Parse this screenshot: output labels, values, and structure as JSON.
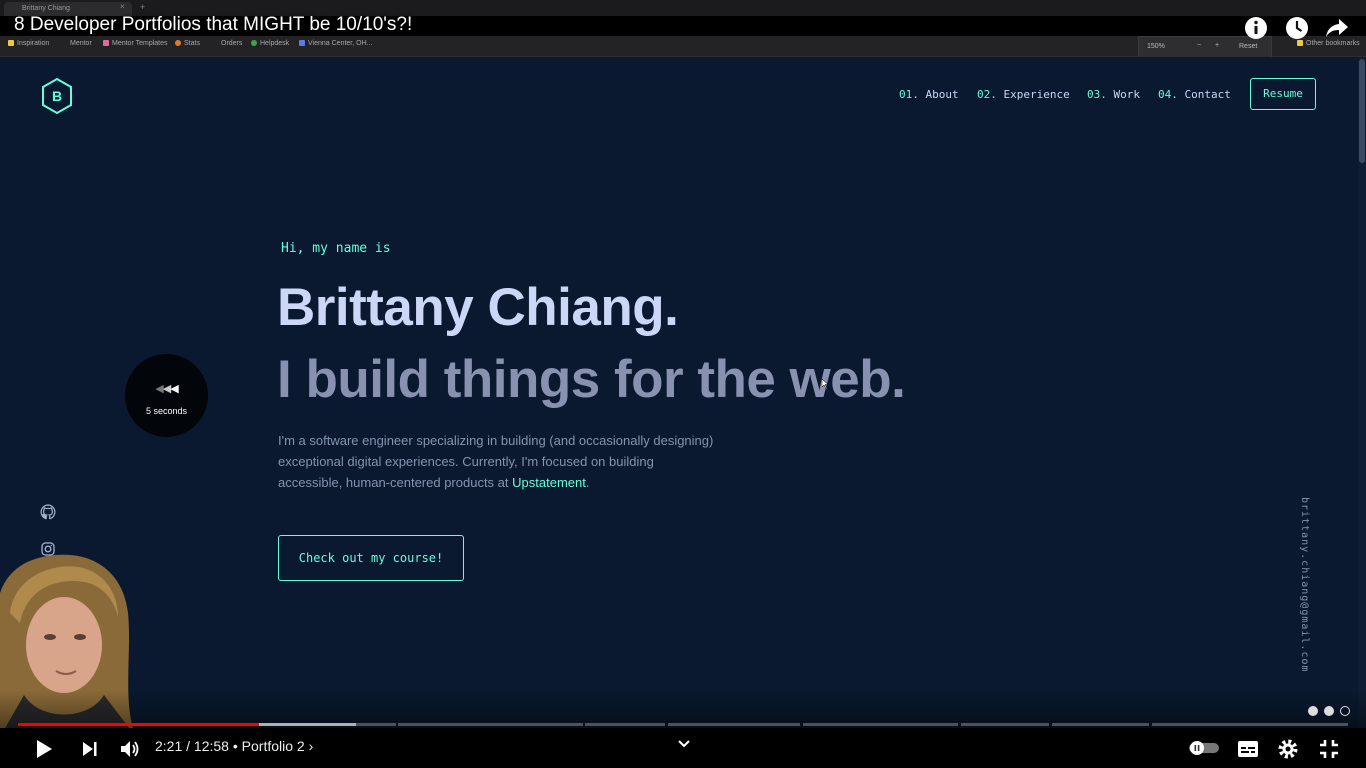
{
  "browser": {
    "tab_title": "Brittany Chiang",
    "tab_close": "×",
    "new_tab": "+",
    "bookmarks": [
      {
        "label": "Inspiration",
        "color": "#f2c744"
      },
      {
        "label": "Mentor",
        "color": "#232326"
      },
      {
        "label": "Mentor Templates",
        "color": "#e06b9f"
      },
      {
        "label": "Stats",
        "color": "#e07a2e"
      },
      {
        "label": "Orders",
        "color": "#232326"
      },
      {
        "label": "Helpdesk",
        "color": "#3aa655"
      },
      {
        "label": "Vienna Center, OH...",
        "color": "#5b7be8"
      }
    ],
    "other_bookmarks": "Other bookmarks",
    "zoom": {
      "level": "150%",
      "minus": "−",
      "plus": "+",
      "reset": "Reset"
    }
  },
  "video": {
    "title": "8 Developer Portfolios that MIGHT be 10/10's?!",
    "time_current": "2:21",
    "time_total": "12:58",
    "chapter": "Portfolio 2",
    "played_fraction": 0.181,
    "buffered_fraction": 0.254,
    "seek_overlay_label": "5 seconds",
    "colors": {
      "progress": "#ff0000",
      "buffered": "rgba(255,255,255,0.55)"
    }
  },
  "portfolio": {
    "logo_letter": "B",
    "nav": [
      {
        "num": "01.",
        "label": "About"
      },
      {
        "num": "02.",
        "label": "Experience"
      },
      {
        "num": "03.",
        "label": "Work"
      },
      {
        "num": "04.",
        "label": "Contact"
      }
    ],
    "resume_label": "Resume",
    "intro": "Hi, my name is",
    "name": "Brittany Chiang.",
    "tagline": "I build things for the web.",
    "description": "I'm a software engineer specializing in building (and occasionally designing) exceptional digital experiences. Currently, I'm focused on building accessible, human-centered products at ",
    "company": "Upstatement",
    "description_end": ".",
    "cta_label": "Check out my course!",
    "email": "brittany.chiang@gmail.com",
    "socials": [
      "github-icon",
      "instagram-icon"
    ],
    "colors": {
      "background": "#0a192f",
      "accent": "#64ffda",
      "heading": "#ccd6f6",
      "text": "#8892b0"
    }
  }
}
